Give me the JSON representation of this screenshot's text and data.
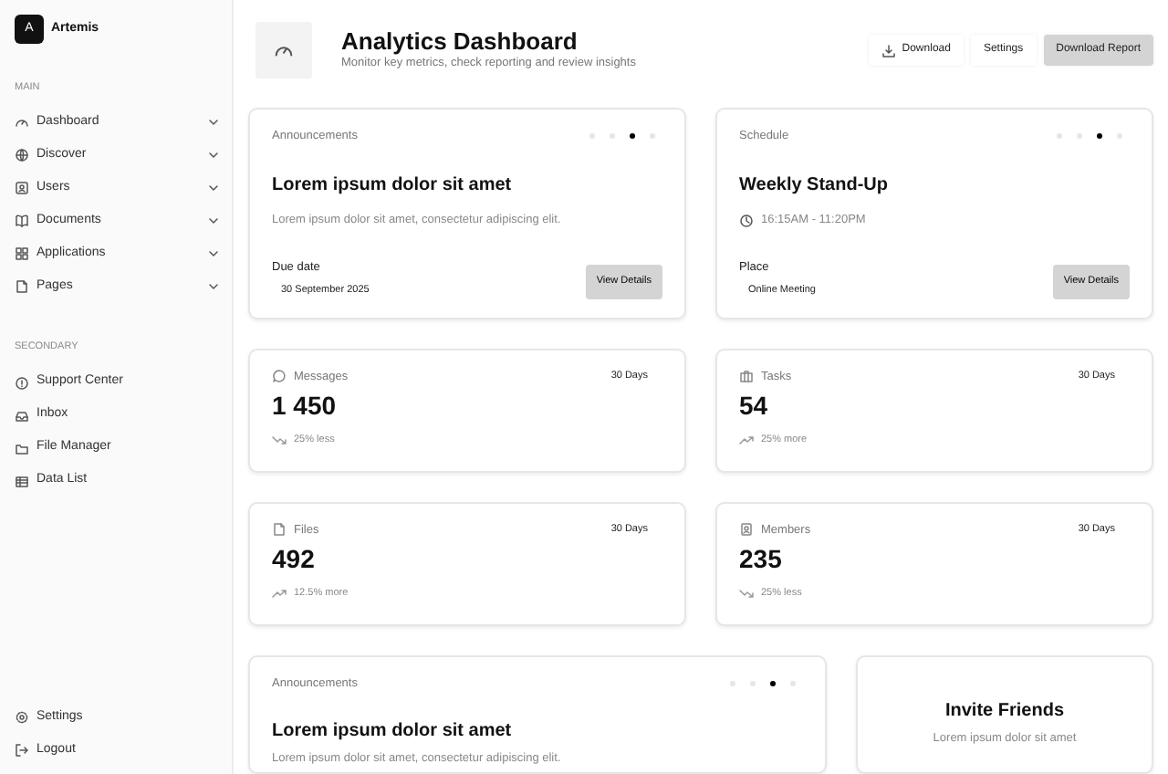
{
  "brand": {
    "initial": "A",
    "name": "Artemis"
  },
  "sidebar": {
    "sections": [
      {
        "label": "MAIN",
        "items": [
          {
            "label": "Dashboard"
          },
          {
            "label": "Discover"
          },
          {
            "label": "Users"
          },
          {
            "label": "Documents"
          },
          {
            "label": "Applications"
          },
          {
            "label": "Pages"
          }
        ]
      },
      {
        "label": "SECONDARY",
        "items": [
          {
            "label": "Support Center"
          },
          {
            "label": "Inbox"
          },
          {
            "label": "File Manager"
          },
          {
            "label": "Data List"
          }
        ]
      }
    ],
    "footer_items": [
      {
        "label": "Settings"
      },
      {
        "label": "Logout"
      }
    ]
  },
  "header": {
    "title": "Analytics Dashboard",
    "subtitle": "Monitor key metrics, check reporting and review insights",
    "buttons": [
      {
        "label": "Download",
        "kind": "icon"
      },
      {
        "label": "Settings",
        "kind": "plain"
      },
      {
        "label": "Download Report",
        "kind": "primary"
      }
    ]
  },
  "info_cards": [
    {
      "kind": "announcement",
      "label": "Announcements",
      "dots": [
        {
          "selected": false
        },
        {
          "selected": false
        },
        {
          "selected": true
        },
        {
          "selected": false
        }
      ],
      "title": "Lorem ipsum dolor sit amet",
      "text": "Lorem ipsum dolor sit amet, consectetur adipiscing elit.",
      "field_label": "Due date",
      "field_value": "30 September 2025",
      "button": "View Details"
    },
    {
      "kind": "schedule",
      "label": "Schedule",
      "dots": [
        {
          "selected": false
        },
        {
          "selected": false
        },
        {
          "selected": true
        },
        {
          "selected": false
        }
      ],
      "title": "Weekly Stand-Up",
      "text": "16:15AM - 11:20PM",
      "field_label": "Place",
      "field_value": "Online Meeting",
      "button": "View Details"
    }
  ],
  "stats": [
    {
      "label": "Messages",
      "period": "30 Days",
      "value": "1 450",
      "trend_up": false,
      "change": "25% less"
    },
    {
      "label": "Tasks",
      "period": "30 Days",
      "value": "54",
      "trend_up": true,
      "change": "25% more"
    },
    {
      "label": "Files",
      "period": "30 Days",
      "value": "492",
      "trend_up": true,
      "change": "12.5% more"
    },
    {
      "label": "Members",
      "period": "30 Days",
      "value": "235",
      "trend_up": false,
      "change": "25% less"
    }
  ],
  "bottom_announcement": {
    "label": "Announcements",
    "dots": [
      {
        "selected": false
      },
      {
        "selected": false
      },
      {
        "selected": true
      },
      {
        "selected": false
      }
    ],
    "title": "Lorem ipsum dolor sit amet",
    "text": "Lorem ipsum dolor sit amet, consectetur adipiscing elit."
  },
  "invite": {
    "title": "Invite Friends",
    "text": "Lorem ipsum dolor sit amet"
  }
}
